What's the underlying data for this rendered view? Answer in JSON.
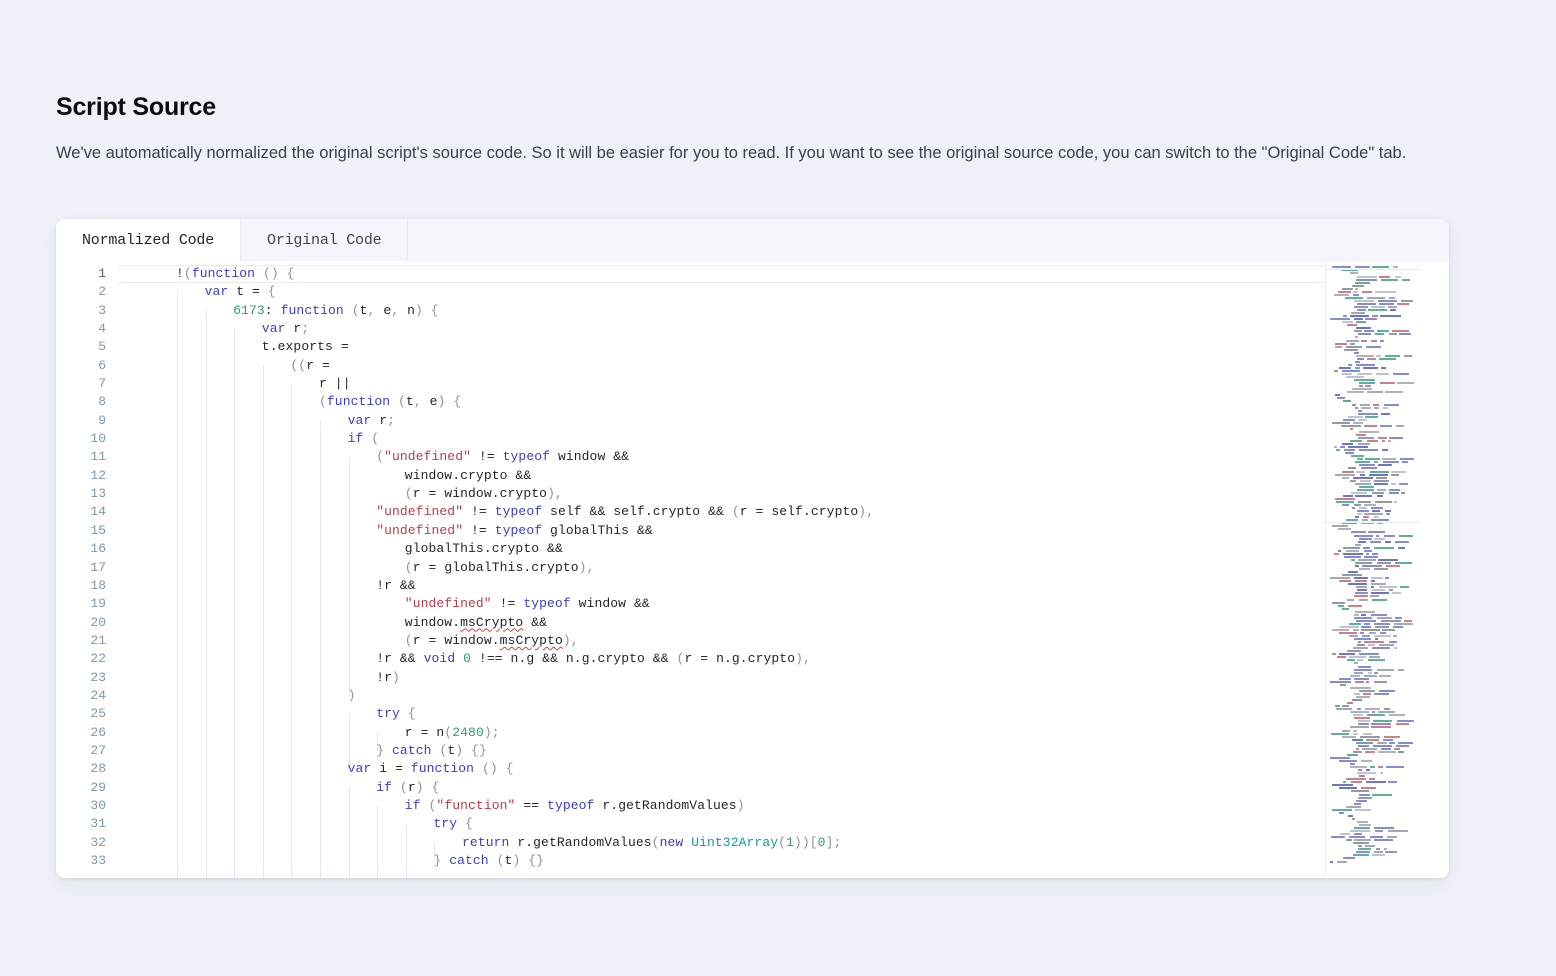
{
  "page": {
    "title": "Script Source",
    "description": "We've automatically normalized the original script's source code. So it will be easier for you to read. If you want to see the original source code, you can switch to the \"Original Code\" tab.",
    "background_color": "#eef1f8",
    "card_color": "#ffffff"
  },
  "tabs": [
    {
      "label": "Normalized Code",
      "active": true
    },
    {
      "label": "Original Code",
      "active": false
    }
  ],
  "editor": {
    "first_line_number": 1,
    "last_line_number": 33,
    "visible_line_count": 33,
    "active_line": 1,
    "theme_colors": {
      "keyword": "#3b3bd6",
      "string": "#c13b4a",
      "number": "#2e9b7a",
      "type": "#0f9ba8",
      "punctuation": "#8c93a3",
      "text": "#22262e",
      "line_number": "#7c99b0",
      "indent_guide": "#e3e7ef"
    },
    "line_numbers": [
      1,
      2,
      3,
      4,
      5,
      6,
      7,
      8,
      9,
      10,
      11,
      12,
      13,
      14,
      15,
      16,
      17,
      18,
      19,
      20,
      21,
      22,
      23,
      24,
      25,
      26,
      27,
      28,
      29,
      30,
      31,
      32,
      33
    ],
    "lines": [
      {
        "n": 1,
        "indent": 0,
        "guides": 0,
        "text": "!(function () {"
      },
      {
        "n": 2,
        "indent": 1,
        "guides": 1,
        "text": "var t = {"
      },
      {
        "n": 3,
        "indent": 2,
        "guides": 2,
        "text": "6173: function (t, e, n) {"
      },
      {
        "n": 4,
        "indent": 3,
        "guides": 3,
        "text": "var r;"
      },
      {
        "n": 5,
        "indent": 3,
        "guides": 3,
        "text": "t.exports ="
      },
      {
        "n": 6,
        "indent": 4,
        "guides": 4,
        "text": "((r ="
      },
      {
        "n": 7,
        "indent": 5,
        "guides": 5,
        "text": "r ||"
      },
      {
        "n": 8,
        "indent": 5,
        "guides": 5,
        "text": "(function (t, e) {"
      },
      {
        "n": 9,
        "indent": 6,
        "guides": 6,
        "text": "var r;"
      },
      {
        "n": 10,
        "indent": 6,
        "guides": 6,
        "text": "if ("
      },
      {
        "n": 11,
        "indent": 7,
        "guides": 7,
        "text": "(\"undefined\" != typeof window &&"
      },
      {
        "n": 12,
        "indent": 8,
        "guides": 7,
        "text": "window.crypto &&"
      },
      {
        "n": 13,
        "indent": 8,
        "guides": 7,
        "text": "(r = window.crypto),"
      },
      {
        "n": 14,
        "indent": 7,
        "guides": 7,
        "text": "\"undefined\" != typeof self && self.crypto && (r = self.crypto),"
      },
      {
        "n": 15,
        "indent": 7,
        "guides": 7,
        "text": "\"undefined\" != typeof globalThis &&"
      },
      {
        "n": 16,
        "indent": 8,
        "guides": 7,
        "text": "globalThis.crypto &&"
      },
      {
        "n": 17,
        "indent": 8,
        "guides": 7,
        "text": "(r = globalThis.crypto),"
      },
      {
        "n": 18,
        "indent": 7,
        "guides": 7,
        "text": "!r &&"
      },
      {
        "n": 19,
        "indent": 8,
        "guides": 7,
        "text": "\"undefined\" != typeof window &&"
      },
      {
        "n": 20,
        "indent": 8,
        "guides": 7,
        "text": "window.msCrypto &&"
      },
      {
        "n": 21,
        "indent": 8,
        "guides": 7,
        "text": "(r = window.msCrypto),"
      },
      {
        "n": 22,
        "indent": 7,
        "guides": 7,
        "text": "!r && void 0 !== n.g && n.g.crypto && (r = n.g.crypto),"
      },
      {
        "n": 23,
        "indent": 7,
        "guides": 7,
        "text": "!r)"
      },
      {
        "n": 24,
        "indent": 6,
        "guides": 6,
        "text": ")"
      },
      {
        "n": 25,
        "indent": 7,
        "guides": 7,
        "text": "try {"
      },
      {
        "n": 26,
        "indent": 8,
        "guides": 8,
        "text": "r = n(2480);"
      },
      {
        "n": 27,
        "indent": 7,
        "guides": 7,
        "text": "} catch (t) {}"
      },
      {
        "n": 28,
        "indent": 6,
        "guides": 6,
        "text": "var i = function () {"
      },
      {
        "n": 29,
        "indent": 7,
        "guides": 7,
        "text": "if (r) {"
      },
      {
        "n": 30,
        "indent": 8,
        "guides": 8,
        "text": "if (\"function\" == typeof r.getRandomValues)"
      },
      {
        "n": 31,
        "indent": 9,
        "guides": 9,
        "text": "try {"
      },
      {
        "n": 32,
        "indent": 10,
        "guides": 10,
        "text": "return r.getRandomValues(new Uint32Array(1))[0];"
      },
      {
        "n": 33,
        "indent": 9,
        "guides": 9,
        "text": "} catch (t) {}"
      }
    ]
  },
  "minimap": {
    "present": true,
    "label": "code-minimap"
  }
}
